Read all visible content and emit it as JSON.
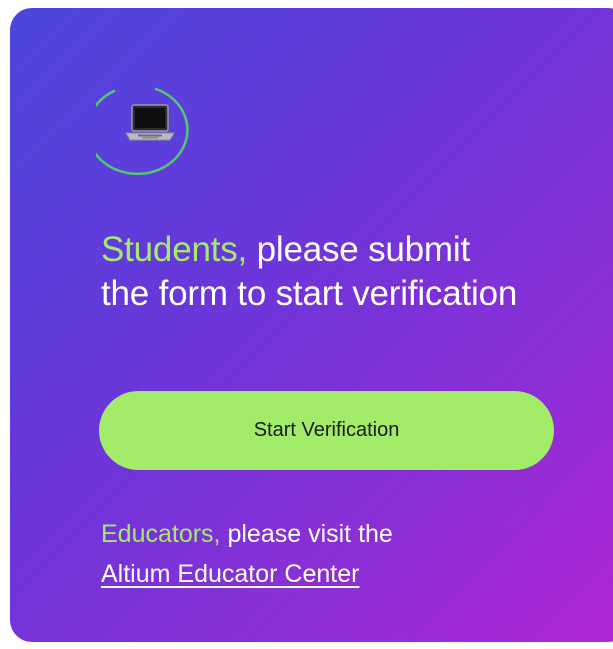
{
  "card": {
    "icon": "laptop-icon",
    "headline": {
      "accent": "Students,",
      "rest": " please submit the form to start verification"
    },
    "cta_label": "Start Verification",
    "educators": {
      "accent": "Educators,",
      "rest": " please visit the",
      "link_label": "Altium Educator Center"
    }
  },
  "colors": {
    "gradient_start": "#4b47dc",
    "gradient_end": "#b125d1",
    "accent_green": "#a6ea6d",
    "button_green": "#a2ec6a"
  }
}
